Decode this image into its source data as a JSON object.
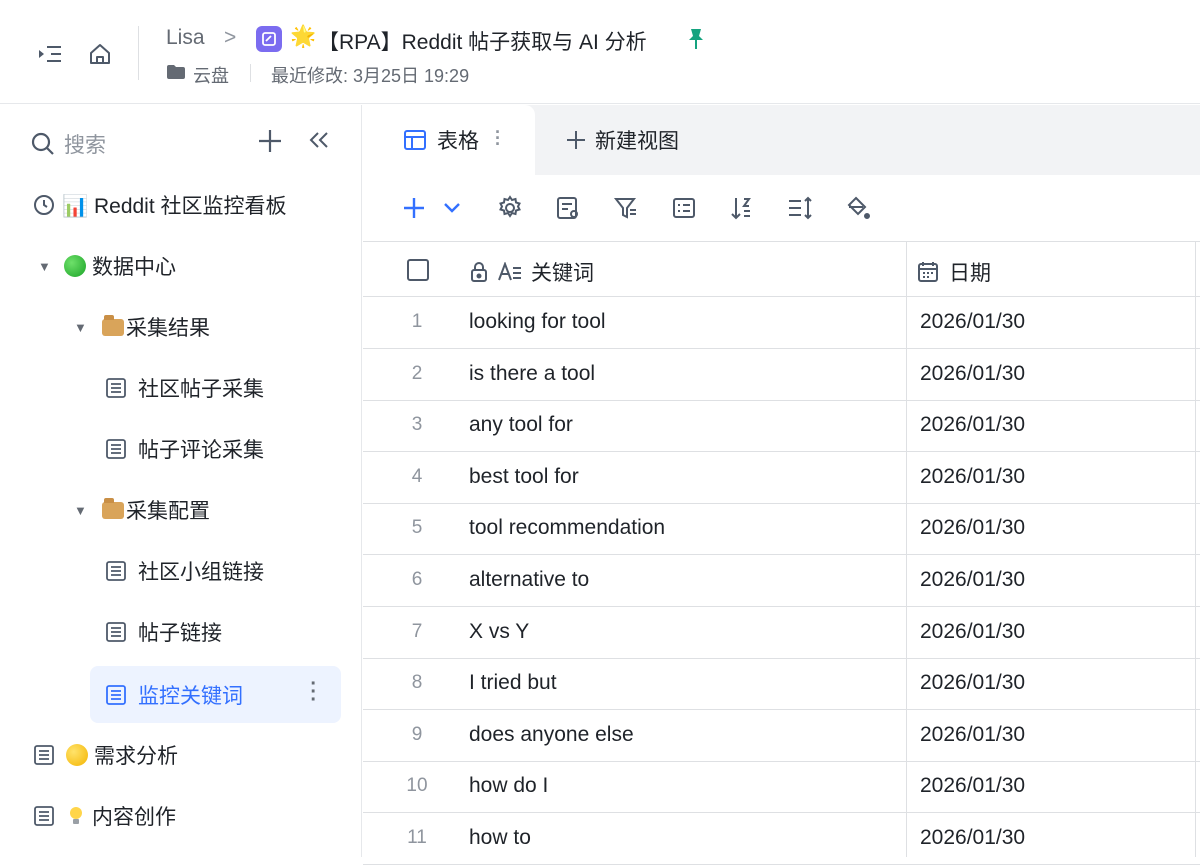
{
  "header": {
    "user": "Lisa",
    "breadcrumb_sep": ">",
    "title_emoji": "🌟",
    "title": "【RPA】Reddit 帖子获取与 AI 分析",
    "location": "云盘",
    "modified": "最近修改: 3月25日 19:29"
  },
  "sidebar": {
    "search_placeholder": "搜索",
    "items": [
      {
        "label": "📊 Reddit 社区监控看板"
      },
      {
        "label": "数据中心"
      },
      {
        "label": "采集结果"
      },
      {
        "label": "社区帖子采集"
      },
      {
        "label": "帖子评论采集"
      },
      {
        "label": "采集配置"
      },
      {
        "label": "社区小组链接"
      },
      {
        "label": "帖子链接"
      },
      {
        "label": "监控关键词"
      },
      {
        "label": "需求分析"
      },
      {
        "label": "内容创作"
      }
    ]
  },
  "tabs": {
    "active_label": "表格",
    "new_view_label": "新建视图"
  },
  "grid": {
    "columns": [
      "关键词",
      "日期"
    ],
    "rows": [
      {
        "num": "1",
        "keyword": "looking for tool",
        "date": "2026/01/30"
      },
      {
        "num": "2",
        "keyword": "is there a tool",
        "date": "2026/01/30"
      },
      {
        "num": "3",
        "keyword": "any tool for",
        "date": "2026/01/30"
      },
      {
        "num": "4",
        "keyword": "best tool for",
        "date": "2026/01/30"
      },
      {
        "num": "5",
        "keyword": "tool recommendation",
        "date": "2026/01/30"
      },
      {
        "num": "6",
        "keyword": "alternative to",
        "date": "2026/01/30"
      },
      {
        "num": "7",
        "keyword": "X vs Y",
        "date": "2026/01/30"
      },
      {
        "num": "8",
        "keyword": "I tried but",
        "date": "2026/01/30"
      },
      {
        "num": "9",
        "keyword": "does anyone else",
        "date": "2026/01/30"
      },
      {
        "num": "10",
        "keyword": "how do I",
        "date": "2026/01/30"
      },
      {
        "num": "11",
        "keyword": "how to",
        "date": "2026/01/30"
      }
    ]
  },
  "colors": {
    "accent": "#3370ff",
    "active_bg": "#edf3ff",
    "pin": "#14a37f"
  }
}
